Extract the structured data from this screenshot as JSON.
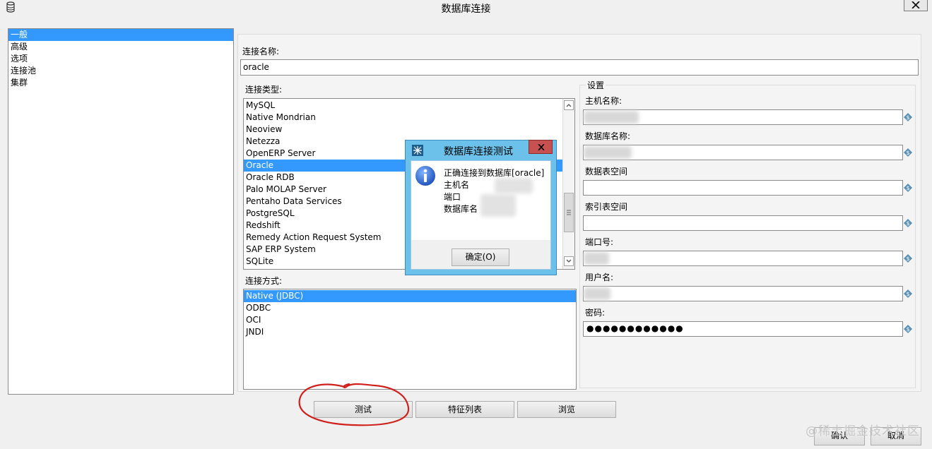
{
  "window": {
    "title": "数据库连接"
  },
  "nav": {
    "items": [
      {
        "label": "一般",
        "selected": true
      },
      {
        "label": "高级",
        "selected": false
      },
      {
        "label": "选项",
        "selected": false
      },
      {
        "label": "连接池",
        "selected": false
      },
      {
        "label": "集群",
        "selected": false
      }
    ]
  },
  "connection": {
    "name_label": "连接名称:",
    "name_value": "oracle",
    "type_label": "连接类型:",
    "types": [
      {
        "label": "MySQL"
      },
      {
        "label": "Native Mondrian"
      },
      {
        "label": "Neoview"
      },
      {
        "label": "Netezza"
      },
      {
        "label": "OpenERP Server"
      },
      {
        "label": "Oracle",
        "selected": true
      },
      {
        "label": "Oracle RDB"
      },
      {
        "label": "Palo MOLAP Server"
      },
      {
        "label": "Pentaho Data Services"
      },
      {
        "label": "PostgreSQL"
      },
      {
        "label": "Redshift"
      },
      {
        "label": "Remedy Action Request System"
      },
      {
        "label": "SAP ERP System"
      },
      {
        "label": "SQLite"
      }
    ],
    "access_label": "连接方式:",
    "access_methods": [
      {
        "label": "Native (JDBC)",
        "selected": true
      },
      {
        "label": "ODBC"
      },
      {
        "label": "OCI"
      },
      {
        "label": "JNDI"
      }
    ]
  },
  "settings": {
    "group_label": "设置",
    "host_label": "主机名称:",
    "db_label": "数据库名称:",
    "tablespace_label": "数据表空间",
    "index_tablespace_label": "索引表空间",
    "port_label": "端口号:",
    "user_label": "用户名:",
    "password_label": "密码:",
    "password_value": "●●●●●●●●●●●●"
  },
  "buttons": {
    "test": "测试",
    "features": "特征列表",
    "explore": "浏览",
    "ok": "确认",
    "cancel": "取消"
  },
  "dialog": {
    "title": "数据库连接测试",
    "line1": "正确连接到数据库[oracle]",
    "line2": "主机名",
    "line3": "端口",
    "line4": "数据库名",
    "ok_label": "确定(O)"
  },
  "watermark": "@稀土掘金技术社区",
  "colors": {
    "selection": "#3399ff",
    "dialog_frame": "#6cc1ea",
    "dialog_close": "#c75050",
    "annotation": "#d0201c"
  }
}
